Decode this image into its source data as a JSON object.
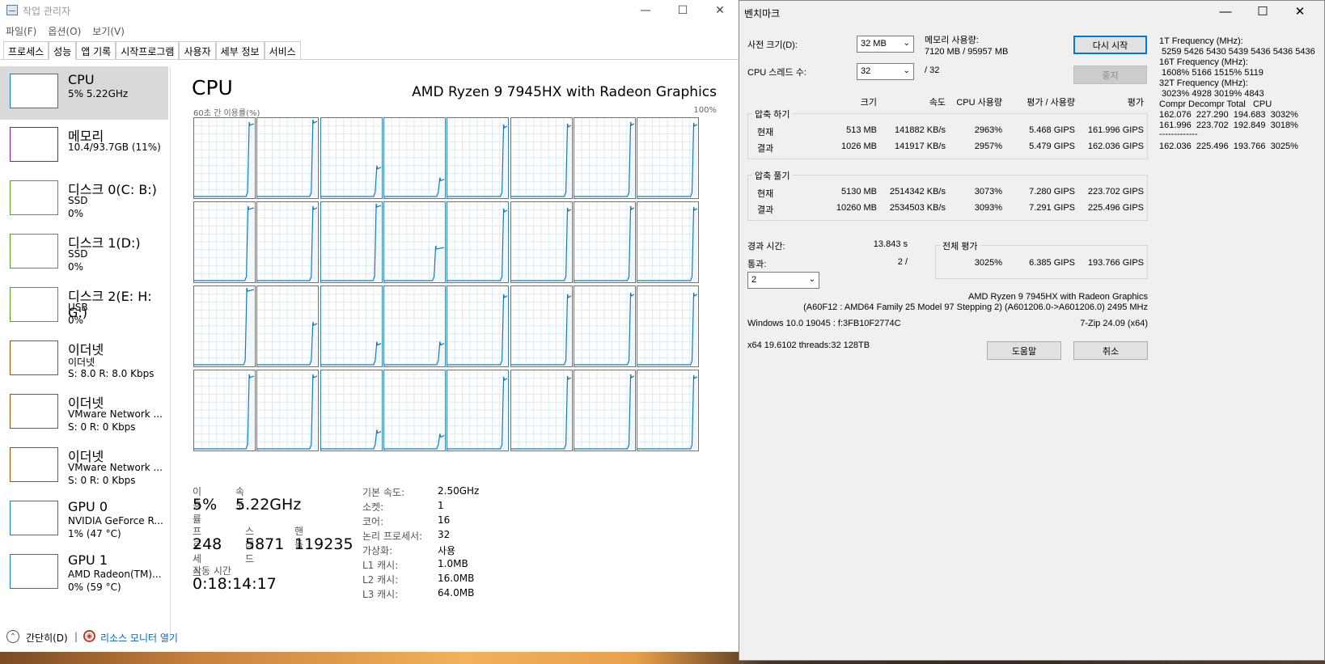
{
  "taskmanager": {
    "title": "작업 관리자",
    "menu": [
      "파일(F)",
      "옵션(O)",
      "보기(V)"
    ],
    "tabs": [
      "프로세스",
      "성능",
      "앱 기록",
      "시작프로그램",
      "사용자",
      "세부 정보",
      "서비스"
    ],
    "active_tab": "성능",
    "sidebar": [
      {
        "name": "CPU",
        "line1": "5% 5.22GHz",
        "line2": "",
        "line3": "",
        "color": "#117dbb"
      },
      {
        "name": "메모리",
        "line1": "10.4/93.7GB (11%)",
        "line2": "",
        "line3": "",
        "color": "#8b12ae"
      },
      {
        "name": "디스크 0(C: B:)",
        "line1": "SSD",
        "line2": "0%",
        "line3": "",
        "color": "#4da60c"
      },
      {
        "name": "디스크 1(D:)",
        "line1": "SSD",
        "line2": "0%",
        "line3": "",
        "color": "#4da60c"
      },
      {
        "name": "디스크 2(E: H: G:)",
        "line1": "USB",
        "line2": "0%",
        "line3": "",
        "color": "#4da60c"
      },
      {
        "name": "이더넷",
        "line1": "이더넷",
        "line2": "S: 8.0 R: 8.0 Kbps",
        "line3": "",
        "color": "#a74f01"
      },
      {
        "name": "이더넷",
        "line1": "VMware Network ...",
        "line2": "S: 0 R: 0 Kbps",
        "line3": "",
        "color": "#a74f01"
      },
      {
        "name": "이더넷",
        "line1": "VMware Network ...",
        "line2": "S: 0 R: 0 Kbps",
        "line3": "",
        "color": "#a74f01"
      },
      {
        "name": "GPU 0",
        "line1": "NVIDIA GeForce R...",
        "line2": "1% (47 °C)",
        "line3": "",
        "color": "#117dbb"
      },
      {
        "name": "GPU 1",
        "line1": "AMD Radeon(TM)...",
        "line2": "0% (59 °C)",
        "line3": "",
        "color": "#117dbb"
      }
    ],
    "main": {
      "title": "CPU",
      "model": "AMD Ryzen 9 7945HX with Radeon Graphics",
      "axis_left": "60초 간 이용률(%)",
      "axis_right": "100%",
      "usage_label": "이용률",
      "usage_value": "5%",
      "speed_label": "속도",
      "speed_value": "5.22GHz",
      "proc_label": "프로세스",
      "proc_value": "248",
      "thread_label": "스레드",
      "thread_value": "5871",
      "handle_label": "핸들",
      "handle_value": "119235",
      "uptime_label": "작동 시간",
      "uptime_value": "0:18:14:17",
      "specs": [
        {
          "k": "기본 속도:",
          "v": "2.50GHz"
        },
        {
          "k": "소켓:",
          "v": "1"
        },
        {
          "k": "코어:",
          "v": "16"
        },
        {
          "k": "논리 프로세서:",
          "v": "32"
        },
        {
          "k": "가상화:",
          "v": "사용"
        },
        {
          "k": "L1 캐시:",
          "v": "1.0MB"
        },
        {
          "k": "L2 캐시:",
          "v": "16.0MB"
        },
        {
          "k": "L3 캐시:",
          "v": "64.0MB"
        }
      ]
    },
    "footer": {
      "simple": "간단히(D)",
      "separator": "|",
      "resource_monitor": "리소스 모니터 열기"
    }
  },
  "benchmark": {
    "title": "벤치마크",
    "dict_label": "사전 크기(D):",
    "dict_value": "32 MB",
    "threads_label": "CPU 스레드 수:",
    "threads_value": "32",
    "threads_of": "/ 32",
    "mem_label": "메모리 사용량:",
    "mem_value": "7120 MB / 95957 MB",
    "restart_button": "다시 시작",
    "stop_button": "중지",
    "headers": [
      "크기",
      "속도",
      "CPU 사용량",
      "평가 / 사용량",
      "평가"
    ],
    "compress_label": "압축 하기",
    "compress_rows": [
      {
        "label": "현재",
        "size": "513 MB",
        "speed": "141882 KB/s",
        "cpu": "2963%",
        "rpu": "5.468 GIPS",
        "rating": "161.996 GIPS"
      },
      {
        "label": "결과",
        "size": "1026 MB",
        "speed": "141917 KB/s",
        "cpu": "2957%",
        "rpu": "5.479 GIPS",
        "rating": "162.036 GIPS"
      }
    ],
    "decompress_label": "압축 풀기",
    "decompress_rows": [
      {
        "label": "현재",
        "size": "5130 MB",
        "speed": "2514342 KB/s",
        "cpu": "3073%",
        "rpu": "7.280 GIPS",
        "rating": "223.702 GIPS"
      },
      {
        "label": "결과",
        "size": "10260 MB",
        "speed": "2534503 KB/s",
        "cpu": "3093%",
        "rpu": "7.291 GIPS",
        "rating": "225.496 GIPS"
      }
    ],
    "elapsed_label": "경과 시간:",
    "elapsed_value": "13.843 s",
    "passes_label": "통과:",
    "passes_value": "2 /",
    "passes_select": "2",
    "total_label": "전체 평가",
    "total_cpu": "3025%",
    "total_rpu": "6.385 GIPS",
    "total_rating": "193.766 GIPS",
    "cpu_name": "AMD Ryzen 9 7945HX with Radeon Graphics",
    "cpu_id": "(A60F12 : AMD64 Family 25 Model 97 Stepping 2) (A601206.0->A601206.0) 2495 MHz",
    "windows": "Windows 10.0 19045 : f:3FB10F2774C",
    "zip_version": "7-Zip 24.09 (x64)",
    "build": "x64 19.6102 threads:32 128TB",
    "help_button": "도움말",
    "cancel_button": "취소",
    "freq_lines": [
      "1T Frequency (MHz):",
      " 5259 5426 5430 5439 5436 5436 5436",
      "16T Frequency (MHz):",
      " 1608% 5166 1515% 5119",
      "32T Frequency (MHz):",
      " 3023% 4928 3019% 4843",
      "Compr Decompr Total   CPU",
      "162.076  227.290  194.683  3032%",
      "161.996  223.702  192.849  3018%",
      "162.036  225.496  193.766  3025%"
    ],
    "ruler_text": "-------------"
  },
  "chart_data": {
    "type": "line",
    "title": "",
    "ylabel": "60초 간 이용률(%)",
    "ylim": [
      0,
      100
    ],
    "x_label": "",
    "note_series": "32 logical processors, usage over last 60 s; near 0 with final spike",
    "series": [
      {
        "values": [
          0,
          0,
          0,
          0,
          0,
          0,
          0,
          0,
          0,
          0,
          0,
          0,
          0,
          0,
          0,
          0,
          0,
          0,
          0,
          0,
          0,
          0,
          0,
          0,
          0,
          0,
          0,
          0,
          0,
          0,
          0,
          0,
          0,
          0,
          0,
          0,
          0,
          0,
          0,
          0,
          0,
          0,
          0,
          0,
          0,
          0,
          0,
          0,
          0,
          0,
          0,
          0,
          0,
          0,
          0,
          0,
          0,
          2,
          100,
          100
        ]
      },
      {
        "values": [
          0,
          0,
          0,
          0,
          0,
          0,
          0,
          0,
          0,
          0,
          0,
          0,
          0,
          0,
          0,
          0,
          0,
          0,
          0,
          0,
          0,
          0,
          0,
          0,
          0,
          0,
          0,
          0,
          0,
          0,
          0,
          0,
          0,
          0,
          0,
          0,
          0,
          0,
          0,
          0,
          0,
          0,
          0,
          0,
          0,
          0,
          0,
          0,
          0,
          0,
          0,
          0,
          0,
          0,
          0,
          0,
          0,
          2,
          100,
          100
        ]
      },
      {
        "values": [
          0,
          0,
          0,
          0,
          0,
          0,
          0,
          0,
          0,
          0,
          0,
          0,
          0,
          0,
          0,
          0,
          0,
          0,
          0,
          0,
          0,
          0,
          0,
          0,
          0,
          0,
          0,
          0,
          0,
          0,
          0,
          0,
          0,
          0,
          0,
          0,
          0,
          0,
          0,
          0,
          0,
          0,
          0,
          0,
          0,
          0,
          0,
          0,
          0,
          0,
          0,
          0,
          0,
          0,
          0,
          0,
          0,
          2,
          100,
          100
        ]
      },
      {
        "values": [
          0,
          0,
          0,
          0,
          0,
          0,
          0,
          0,
          0,
          0,
          0,
          0,
          0,
          0,
          0,
          0,
          0,
          0,
          0,
          0,
          0,
          0,
          0,
          0,
          0,
          0,
          0,
          0,
          0,
          0,
          0,
          0,
          0,
          0,
          0,
          0,
          0,
          0,
          0,
          0,
          0,
          0,
          0,
          0,
          0,
          0,
          0,
          0,
          0,
          0,
          0,
          0,
          0,
          0,
          0,
          0,
          0,
          2,
          100,
          100
        ]
      }
    ]
  },
  "colors": {
    "cpu_line": "#117dbb",
    "cpu_fill": "#f1f6fa",
    "grid": "#d9eaf4",
    "border": "#2f80c8"
  }
}
